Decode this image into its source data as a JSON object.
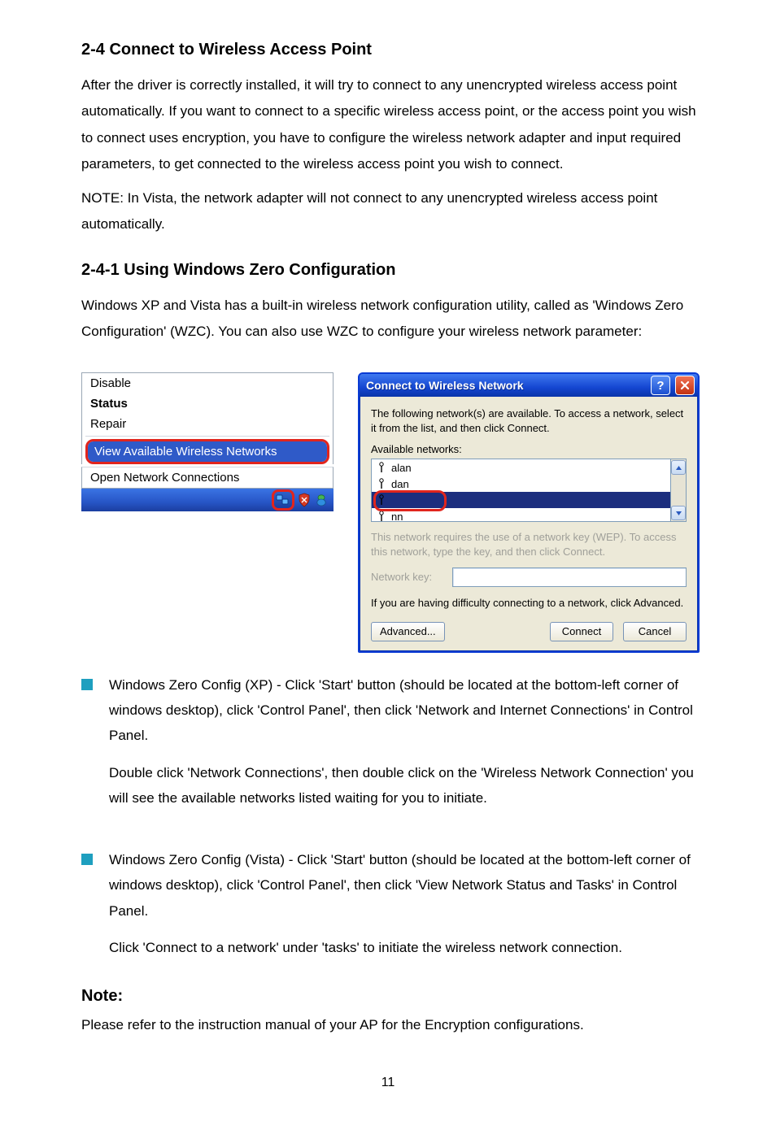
{
  "pageNumber": "11",
  "section1": {
    "heading": "2-4 Connect to Wireless Access Point",
    "para": "After the driver is correctly installed, it will try to connect to any unencrypted wireless access point automatically. If you want to connect to a specific wireless access point, or the access point you wish to connect uses encryption, you have to configure the wireless network adapter and input required parameters, to get connected to the wireless access point you wish to connect.",
    "note": "NOTE: In Vista, the network adapter will not connect to any unencrypted wireless access point automatically."
  },
  "section2": {
    "heading": "2-4-1 Using Windows Zero Configuration",
    "para": "Windows XP and Vista has a built-in wireless network configuration utility, called as 'Windows Zero Configuration' (WZC). You can also use WZC to configure your wireless network parameter:"
  },
  "contextMenu": {
    "items": [
      "Disable",
      "Status",
      "Repair"
    ],
    "highlighted": "View Available Wireless Networks",
    "after": "Open Network Connections"
  },
  "dialog": {
    "title": "Connect to Wireless Network",
    "instr": "The following network(s) are available. To access a network, select it from the list, and then click Connect.",
    "availLabel": "Available networks:",
    "networks": [
      "alan",
      "dan",
      "",
      "nn"
    ],
    "selectedIndex": 2,
    "hint": "This network requires the use of a network key (WEP). To access this network, type the key, and then click Connect.",
    "keyLabel": "Network key:",
    "keyValue": "",
    "advText": "If you are having difficulty connecting to a network, click Advanced.",
    "buttons": {
      "advanced": "Advanced...",
      "connect": "Connect",
      "cancel": "Cancel"
    }
  },
  "bullets": {
    "b1": "Windows Zero Config (XP) - Click 'Start' button (should be located at the bottom-left corner of windows desktop), click 'Control Panel', then click 'Network and Internet Connections' in Control Panel.",
    "b1b": "Double click 'Network Connections', then double click on the 'Wireless Network Connection' you will see the available networks listed waiting for you to initiate.",
    "b2": "Windows Zero Config (Vista) - Click 'Start' button (should be located at the bottom-left corner of windows desktop), click 'Control Panel', then click 'View Network Status and Tasks' in Control Panel.",
    "b2b": "Click 'Connect to a network' under 'tasks' to initiate the wireless network connection."
  },
  "note2": {
    "heading": "Note:",
    "body": "Please refer to the instruction manual of your AP for the Encryption configurations."
  }
}
